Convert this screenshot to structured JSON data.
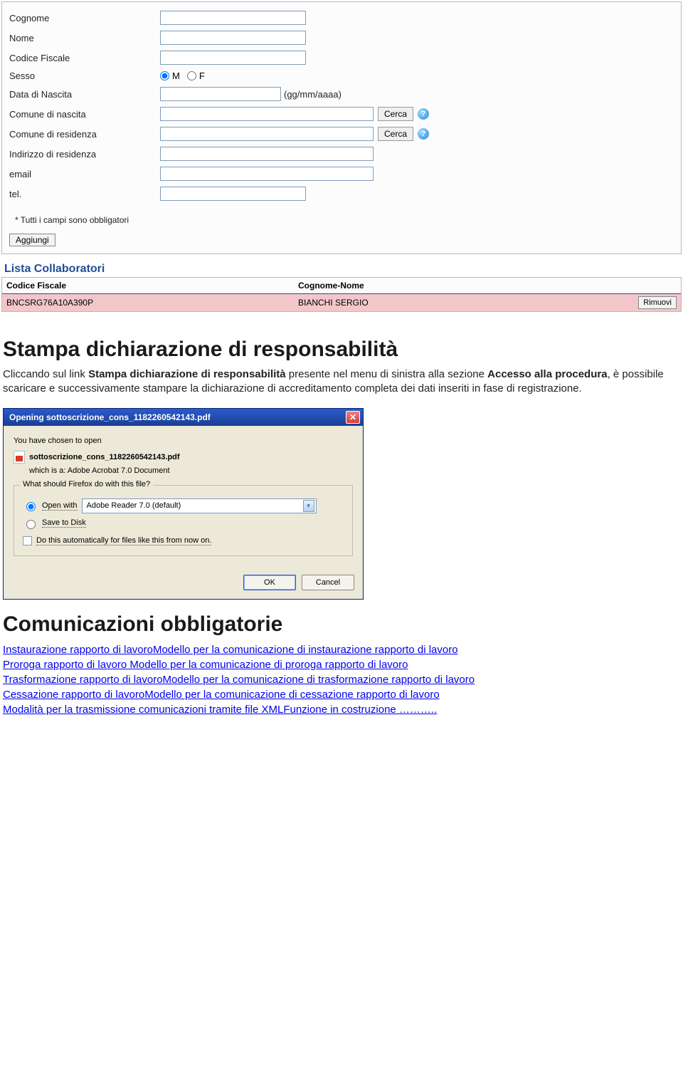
{
  "form": {
    "labels": {
      "cognome": "Cognome",
      "nome": "Nome",
      "cf": "Codice Fiscale",
      "sesso": "Sesso",
      "sesso_m": "M",
      "sesso_f": "F",
      "nascita": "Data di Nascita",
      "nascita_hint": "(gg/mm/aaaa)",
      "comune_nascita": "Comune di nascita",
      "comune_residenza": "Comune di residenza",
      "indirizzo": "Indirizzo di residenza",
      "email": "email",
      "tel": "tel."
    },
    "cerca": "Cerca",
    "note": "* Tutti i campi sono obbligatori",
    "aggiungi": "Aggiungi"
  },
  "collaboratori": {
    "title": "Lista Collaboratori",
    "col_cf": "Codice Fiscale",
    "col_name": "Cognome-Nome",
    "rimuovi": "Rimuovi",
    "rows": [
      {
        "cf": "BNCSRG76A10A390P",
        "name": "BIANCHI SERGIO"
      }
    ]
  },
  "stampa": {
    "heading": "Stampa dichiarazione di responsabilità",
    "p_pre": "Cliccando sul link ",
    "p_b1": "Stampa dichiarazione di responsabilità",
    "p_mid": " presente nel menu di sinistra alla sezione ",
    "p_b2": "Accesso alla procedura",
    "p_post": ", è possibile scaricare e successivamente stampare la dichiarazione di accreditamento completa dei dati inseriti in fase di registrazione."
  },
  "dialog": {
    "title": "Opening sottoscrizione_cons_1182260542143.pdf",
    "chosen": "You have chosen to open",
    "filename": "sottoscrizione_cons_1182260542143.pdf",
    "which_is": "which is a:  Adobe Acrobat 7.0 Document",
    "legend": "What should Firefox do with this file?",
    "open_with": "Open with",
    "open_with_app": "Adobe Reader 7.0 (default)",
    "save": "Save to Disk",
    "auto": "Do this automatically for files like this from now on.",
    "ok": "OK",
    "cancel": "Cancel"
  },
  "comunicazioni": {
    "heading": "Comunicazioni obbligatorie",
    "l1a": "Instaurazione rapporto di lavoro",
    "l1b": "Modello per la comunicazione di instaurazione rapporto di lavoro",
    "l2a": "Proroga rapporto di lavoro",
    "l2b": " Modello per la comunicazione di proroga rapporto di lavoro",
    "l3a": "Trasformazione rapporto di lavoro",
    "l3b": "Modello per la comunicazione di trasformazione rapporto di lavoro",
    "l4a": "Cessazione rapporto di lavoro",
    "l4b": "Modello per la comunicazione di cessazione rapporto di lavoro",
    "l5a": "Modalità per la trasmissione comunicazioni tramite file XML",
    "l5b": "Funzione in costruzione ……….."
  }
}
